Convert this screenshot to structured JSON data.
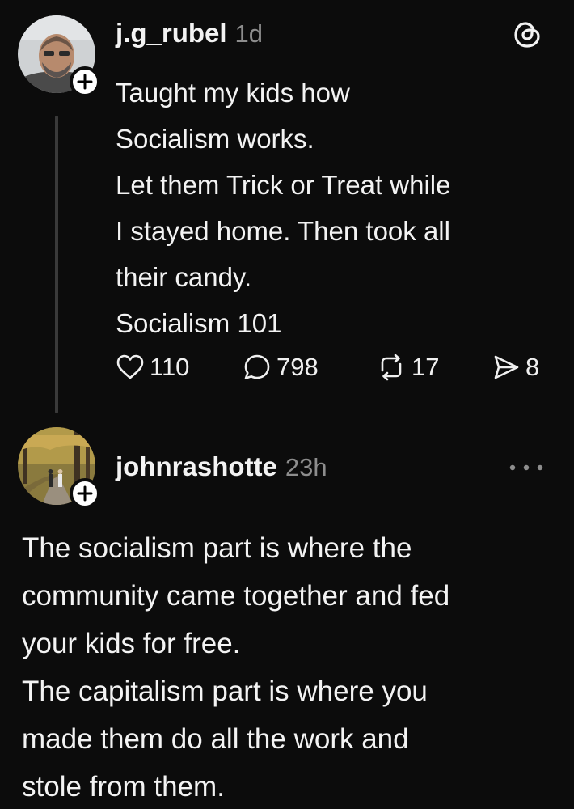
{
  "post": {
    "username": "j.g_rubel",
    "timestamp": "1d",
    "lines": [
      "Taught my kids how",
      "Socialism works.",
      "Let them Trick or Treat while",
      "I stayed home. Then took all",
      "their candy.",
      "Socialism 101"
    ],
    "likes": "110",
    "replies": "798",
    "reposts": "17",
    "shares": "8"
  },
  "reply": {
    "username": "johnrashotte",
    "timestamp": "23h",
    "lines": [
      "The socialism part is where the",
      "community came together and fed",
      "your kids for free.",
      "The capitalism part is where you",
      "made them do all the work and",
      "stole from them."
    ]
  },
  "icons": {
    "like": "heart-icon",
    "reply": "speech-bubble-icon",
    "repost": "repost-icon",
    "share": "send-icon",
    "app": "threads-logo-icon",
    "more": "more-options-icon",
    "follow": "plus-icon"
  },
  "colors": {
    "background": "#0c0c0c",
    "text": "#f3f3f3",
    "muted": "#8d8d8d"
  }
}
